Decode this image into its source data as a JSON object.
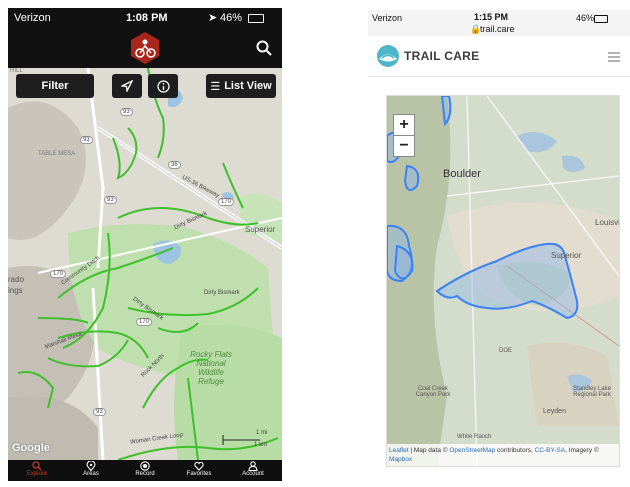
{
  "left_app": {
    "status": {
      "carrier": "Verizon",
      "time": "1:08 PM",
      "battery": "46%"
    },
    "buttons": {
      "filter": "Filter",
      "list_view": "List View"
    },
    "map_labels": {
      "table_mesa": "TABLE MESA",
      "us36": "US-36 Bikeway",
      "dirty_bismark_1": "Dirty Bismark",
      "superior": "Superior",
      "community_ditch": "Community Ditch",
      "dirty_bismark_2": "Dirty Bismark",
      "dirty_bismark_3": "Dirty Bismark",
      "marshall_mesa": "Marshall Mesa",
      "rocky_flats": "Rocky Flats National Wildlife Refuge",
      "rock_north": "Rock North",
      "woman_creek": "Woman Creek Loop",
      "rado": "rado",
      "ings": "ings",
      "hill": "HILL",
      "scale_mi": "1 mi",
      "scale_km": "1 km",
      "google": "Google"
    },
    "road_numbers": [
      "93",
      "93",
      "36",
      "170",
      "170",
      "170",
      "93",
      "93"
    ],
    "tabs": [
      {
        "label": "Explore",
        "icon": "search-icon"
      },
      {
        "label": "Areas",
        "icon": "map-pin-icon"
      },
      {
        "label": "Record",
        "icon": "record-icon"
      },
      {
        "label": "Favorites",
        "icon": "heart-icon"
      },
      {
        "label": "Account",
        "icon": "user-icon"
      }
    ],
    "colors": {
      "trail": "#3fbf2a",
      "accent": "#c0392b",
      "bar": "#111111"
    }
  },
  "right_app": {
    "status": {
      "carrier": "Verizon",
      "time": "1:15 PM",
      "battery": "46%",
      "url": "trail.care"
    },
    "brand": "TRAIL CARE",
    "map_labels": {
      "boulder": "Boulder",
      "louisville": "Louisvi",
      "superior": "Superior",
      "doe": "DOE",
      "coal_creek": "Coal Creek Canyon Park",
      "standley": "Standley Lake Regional Park",
      "leyden": "Leyden",
      "white_ranch": "White Ranch"
    },
    "zoom": {
      "in": "+",
      "out": "−"
    },
    "attribution": {
      "leaflet": "Leaflet",
      "pre": " | Map data © ",
      "osm": "OpenStreetMap",
      "mid": " contributors, ",
      "cc": "CC-BY-SA",
      "imagery": ", Imagery © ",
      "mapbox": "Mapbox"
    },
    "colors": {
      "polygon": "#3b82f6",
      "brand": "#4db6c8"
    }
  }
}
